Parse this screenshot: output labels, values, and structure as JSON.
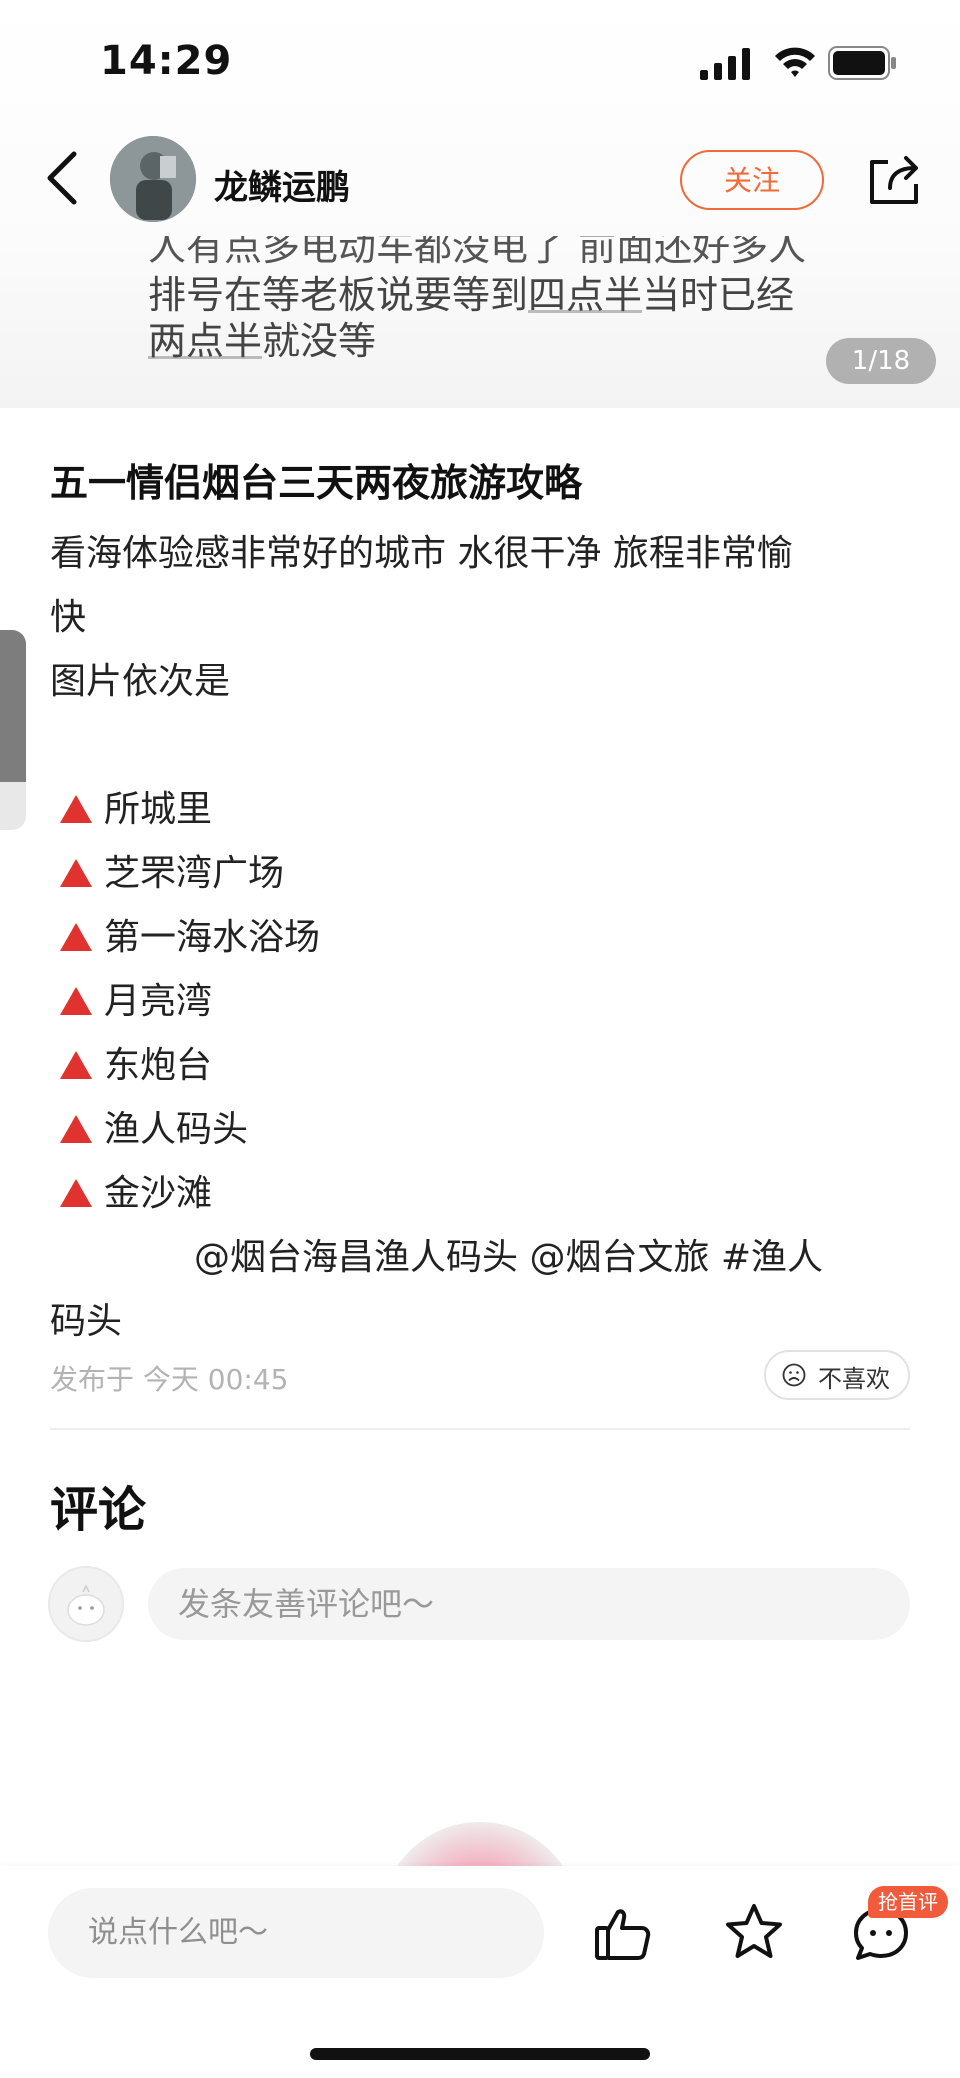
{
  "status_bar": {
    "time": "14:29"
  },
  "header": {
    "author_name": "龙鳞运鹏",
    "follow_label": "关注"
  },
  "hero": {
    "caption_line1": "人有点多电动车都没电了 前面还好多人",
    "caption_line2_a": "排号在等老板说要等到",
    "caption_line2_b": "四点半",
    "caption_line2_c": "当时已经",
    "caption_line3_a": "两点半",
    "caption_line3_b": "就没等",
    "page_counter": "1/18"
  },
  "post": {
    "title": "五一情侣烟台三天两夜旅游攻略",
    "intro_line1": "看海体验感非常好的城市 水很干净 旅程非常愉",
    "intro_line2": "快",
    "intro_line3": "图片依次是",
    "items": [
      "所城里",
      "芝罘湾广场",
      "第一海水浴场",
      "月亮湾",
      "东炮台",
      "渔人码头",
      "金沙滩"
    ],
    "tags_line1": "@烟台海昌渔人码头 @烟台文旅 #渔人",
    "tags_line2": "码头",
    "publish_time": "发布于 今天 00:45",
    "dislike_label": "不喜欢",
    "bullet_color": "#e0322e"
  },
  "comments": {
    "heading": "评论",
    "input_placeholder": "发条友善评论吧～"
  },
  "bottom_bar": {
    "input_placeholder": "说点什么吧～",
    "first_comment_badge": "抢首评",
    "icons": [
      "like-icon",
      "star-icon",
      "comment-icon"
    ]
  },
  "colors": {
    "accent": "#f06a3a",
    "badge": "#f15a3b"
  }
}
